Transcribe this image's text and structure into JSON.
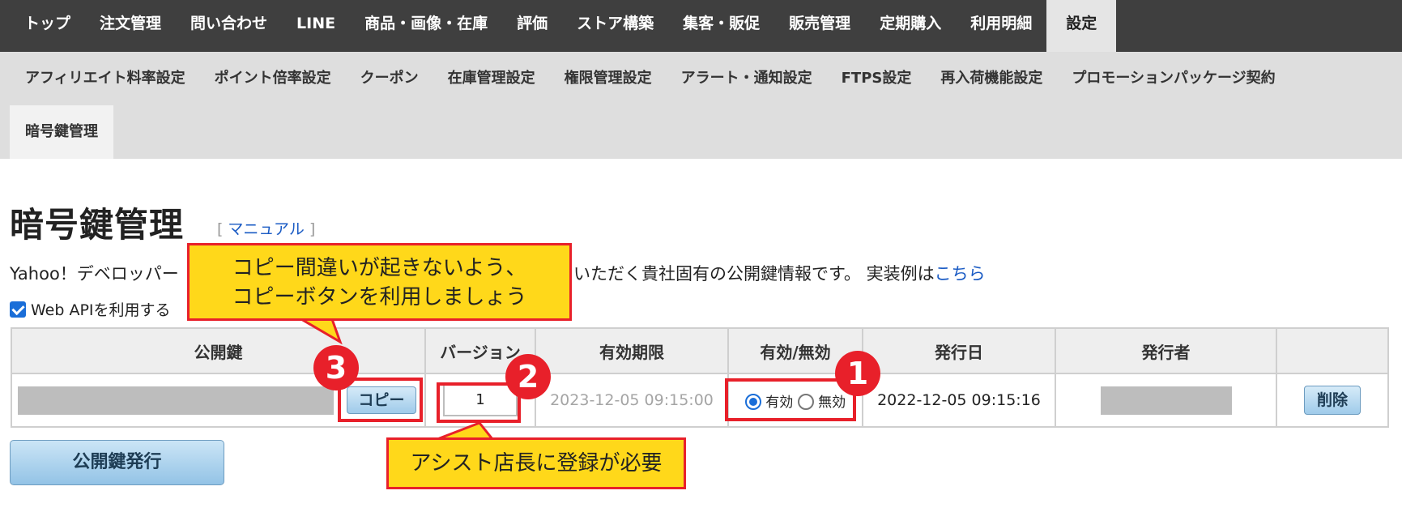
{
  "top_nav": {
    "tabs": [
      {
        "label": "トップ"
      },
      {
        "label": "注文管理"
      },
      {
        "label": "問い合わせ"
      },
      {
        "label": "LINE"
      },
      {
        "label": "商品・画像・在庫"
      },
      {
        "label": "評価"
      },
      {
        "label": "ストア構築"
      },
      {
        "label": "集客・販促"
      },
      {
        "label": "販売管理"
      },
      {
        "label": "定期購入"
      },
      {
        "label": "利用明細"
      },
      {
        "label": "設定"
      }
    ],
    "active": "設定"
  },
  "sub_nav": {
    "items": [
      {
        "label": "アフィリエイト料率設定"
      },
      {
        "label": "ポイント倍率設定"
      },
      {
        "label": "クーポン"
      },
      {
        "label": "在庫管理設定"
      },
      {
        "label": "権限管理設定"
      },
      {
        "label": "アラート・通知設定"
      },
      {
        "label": "FTPS設定"
      },
      {
        "label": "再入荷機能設定"
      },
      {
        "label": "プロモーションパッケージ契約"
      },
      {
        "label": "暗号鍵管理"
      }
    ],
    "active": "暗号鍵管理"
  },
  "page": {
    "title": "暗号鍵管理",
    "manual_link": "マニュアル",
    "desc_left": "Yahoo！デベロッパー",
    "desc_right": "いただく貴社固有の公開鍵情報です。 実装例は",
    "desc_link": "こちら",
    "webapi_checkbox_label": "Web APIを利用する",
    "webapi_checked": true
  },
  "table": {
    "headers": [
      "公開鍵",
      "バージョン",
      "有効期限",
      "有効/無効",
      "発行日",
      "発行者",
      ""
    ],
    "row": {
      "copy_button": "コピー",
      "version": "1",
      "expiry": "2023-12-05 09:15:00",
      "status_options": [
        "有効",
        "無効"
      ],
      "status_selected": "有効",
      "issued_at": "2022-12-05 09:15:16",
      "delete_button": "削除"
    }
  },
  "issue_button": "公開鍵発行",
  "callouts": {
    "copy": [
      "コピー間違いが起きないよう、",
      "コピーボタンを利用しましょう"
    ],
    "register": "アシスト店長に登録が必要",
    "badges": [
      "3",
      "2",
      "1"
    ]
  },
  "colors": {
    "nav_bg": "#3f3f3f",
    "subnav_bg": "#dedede",
    "accent": "#1a6ed8",
    "annotation_red": "#e8202a",
    "annotation_yellow": "#ffd81a"
  }
}
